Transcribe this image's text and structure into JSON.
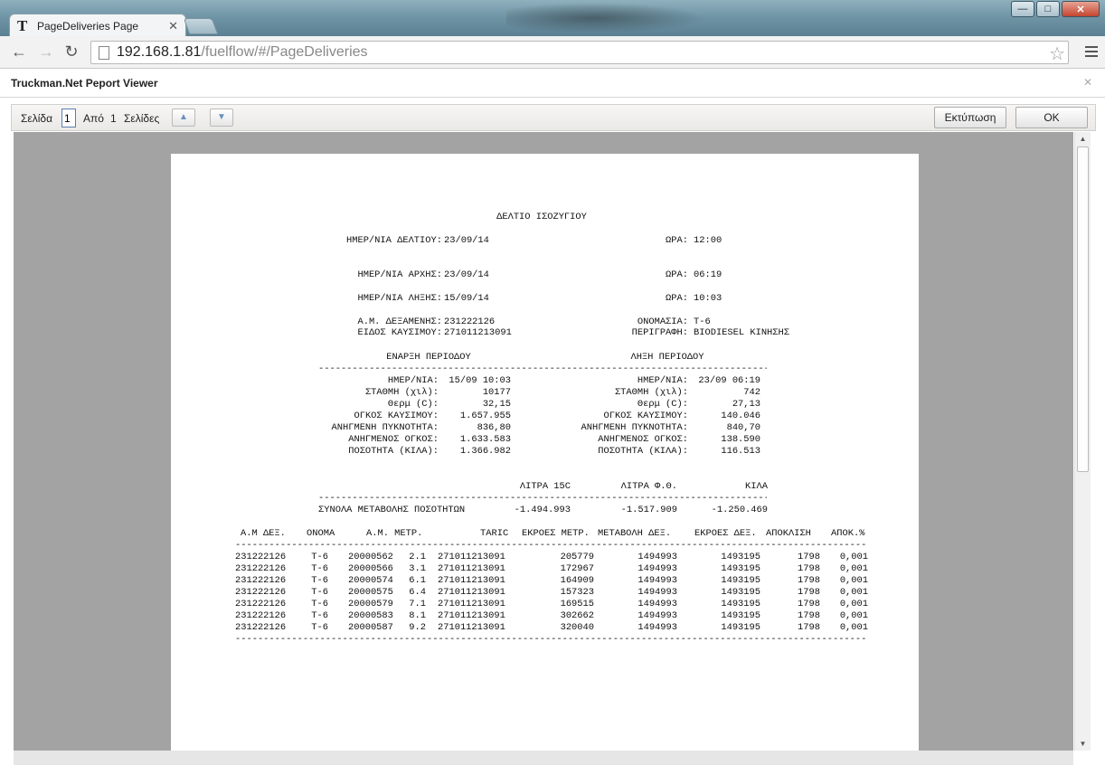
{
  "browser": {
    "tab_title": "PageDeliveries Page",
    "tab_favicon": "T",
    "url_host": "192.168.1.81",
    "url_path": "/fuelflow/#/PageDeliveries"
  },
  "viewer": {
    "title": "Truckman.Net Peport Viewer",
    "page_label": "Σελίδα",
    "page_value": "1",
    "of_label": "Από",
    "total_pages": "1",
    "pages_label": "Σελίδες",
    "print_label": "Εκτύπωση",
    "ok_label": "OK"
  },
  "report": {
    "title": "ΔΕΛΤΙΟ ΙΣΟΖΥΓΙΟΥ",
    "header": {
      "date_label": "ΗΜΕΡ/ΝΙΑ ΔΕΛΤΙΟΥ:",
      "date": "23/09/14",
      "time_label": "ΩΡΑ:",
      "time": "12:00",
      "start_label": "ΗΜΕΡ/ΝΙΑ ΑΡΧΗΣ:",
      "start": "23/09/14",
      "start_time_label": "ΩΡΑ:",
      "start_time": "06:19",
      "end_label": "ΗΜΕΡ/ΝΙΑ ΛΗΞΗΣ:",
      "end": "15/09/14",
      "end_time_label": "ΩΡΑ:",
      "end_time": "10:03",
      "tank_label": "Α.Μ. ΔΕΞΑΜΕΝΗΣ:",
      "tank": "231222126",
      "name_label": "ΟΝΟΜΑΣΙΑ:",
      "name": "T-6",
      "fuel_label": "ΕΙΔΟΣ ΚΑΥΣΙΜΟΥ:",
      "fuel": "271011213091",
      "desc_label": "ΠΕΡΙΓΡΑΦΗ:",
      "desc": "BIODIESEL ΚΙΝΗΣΗΣ"
    },
    "period": {
      "start_title": "ΕΝΑΡΞΗ ΠΕΡΙΟΔΟΥ",
      "end_title": "ΛΗΞΗ ΠΕΡΙΟΔΟΥ",
      "rows": [
        {
          "label": "ΗΜΕΡ/ΝΙΑ:",
          "start": "15/09 10:03",
          "end": "23/09 06:19"
        },
        {
          "label": "ΣΤΑΘΜΗ (χιλ):",
          "start": "10177",
          "end": "742"
        },
        {
          "label": "Θερμ (C):",
          "start": "32,15",
          "end": "27,13"
        },
        {
          "label": "ΟΓΚΟΣ ΚΑΥΣΙΜΟΥ:",
          "start": "1.657.955",
          "end": "140.046"
        },
        {
          "label": "ΑΝΗΓΜΕΝΗ ΠΥΚΝΟΤΗΤΑ:",
          "start": "836,80",
          "end": "840,70"
        },
        {
          "label": "ΑΝΗΓΜΕΝΟΣ ΟΓΚΟΣ:",
          "start": "1.633.583",
          "end": "138.590"
        },
        {
          "label": "ΠΟΣΟΤΗΤΑ (ΚΙΛΑ):",
          "start": "1.366.982",
          "end": "116.513"
        }
      ]
    },
    "totals": {
      "col1": "ΛΙΤΡΑ 15C",
      "col2": "ΛΙΤΡΑ Φ.Θ.",
      "col3": "ΚΙΛΑ",
      "label": "ΣΥΝΟΛΑ ΜΕΤΑΒΟΛΗΣ ΠΟΣΟΤΗΤΩΝ",
      "v1": "-1.494.993",
      "v2": "-1.517.909",
      "v3": "-1.250.469"
    },
    "table": {
      "headers": [
        "Α.Μ ΔΕΞ.",
        "ΟΝΟΜΑ",
        "Α.Μ. ΜΕΤΡ.",
        "TARIC",
        "ΕΚΡΟΕΣ ΜΕΤΡ.",
        "ΜΕΤΑΒΟΛΗ ΔΕΞ.",
        "ΕΚΡΟΕΣ ΔΕΞ.",
        "ΑΠΟΚΛΙΣΗ",
        "ΑΠΟΚ.%"
      ],
      "rows": [
        [
          "231222126",
          "T-6",
          "20000562",
          "2.1",
          "271011213091",
          "205779",
          "1494993",
          "1493195",
          "1798",
          "0,001"
        ],
        [
          "231222126",
          "T-6",
          "20000566",
          "3.1",
          "271011213091",
          "172967",
          "1494993",
          "1493195",
          "1798",
          "0,001"
        ],
        [
          "231222126",
          "T-6",
          "20000574",
          "6.1",
          "271011213091",
          "164909",
          "1494993",
          "1493195",
          "1798",
          "0,001"
        ],
        [
          "231222126",
          "T-6",
          "20000575",
          "6.4",
          "271011213091",
          "157323",
          "1494993",
          "1493195",
          "1798",
          "0,001"
        ],
        [
          "231222126",
          "T-6",
          "20000579",
          "7.1",
          "271011213091",
          "169515",
          "1494993",
          "1493195",
          "1798",
          "0,001"
        ],
        [
          "231222126",
          "T-6",
          "20000583",
          "8.1",
          "271011213091",
          "302662",
          "1494993",
          "1493195",
          "1798",
          "0,001"
        ],
        [
          "231222126",
          "T-6",
          "20000587",
          "9.2",
          "271011213091",
          "320040",
          "1494993",
          "1493195",
          "1798",
          "0,001"
        ]
      ]
    }
  }
}
